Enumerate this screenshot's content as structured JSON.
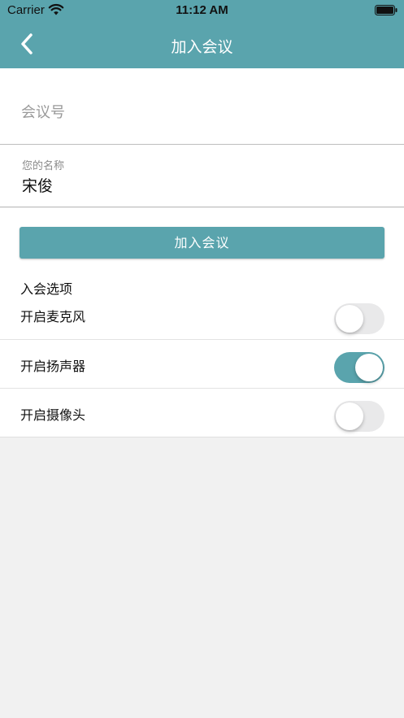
{
  "status_bar": {
    "carrier": "Carrier",
    "time": "11:12 AM"
  },
  "nav": {
    "title": "加入会议",
    "back_icon": "chevron-left-icon"
  },
  "form": {
    "meeting_number": {
      "placeholder": "会议号",
      "value": ""
    },
    "display_name": {
      "label": "您的名称",
      "value": "宋俊"
    }
  },
  "join_button": {
    "label": "加入会议"
  },
  "options": {
    "heading": "入会选项",
    "items": [
      {
        "label": "开启麦克风",
        "enabled": false
      },
      {
        "label": "开启扬声器",
        "enabled": true
      },
      {
        "label": "开启摄像头",
        "enabled": false
      }
    ]
  },
  "colors": {
    "accent": "#5aa4ad",
    "background": "#f1f1f1",
    "toggle_off": "#e9e9ea"
  }
}
